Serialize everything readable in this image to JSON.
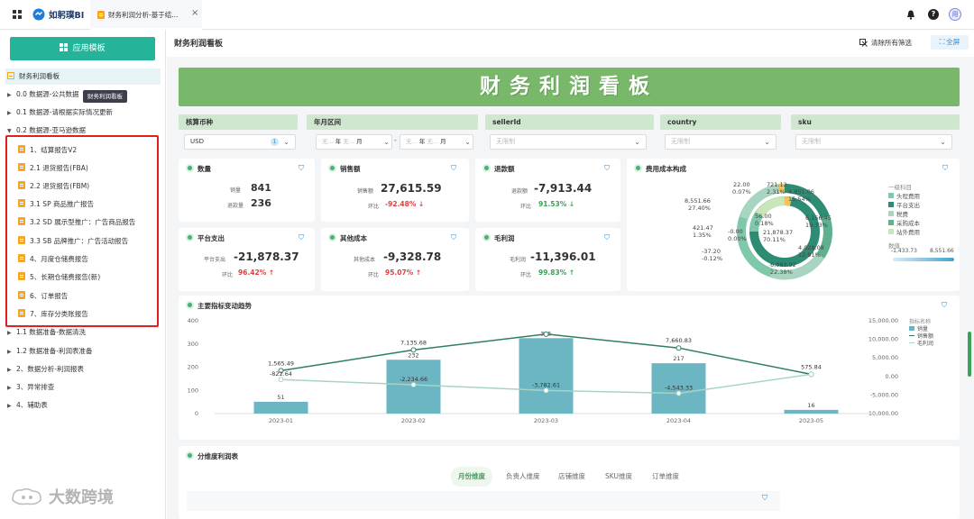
{
  "topbar": {
    "logo_text": "如躬璞BI",
    "tab_title": "财务利润分析-基于结...",
    "tab_close": "×"
  },
  "sidebar": {
    "template_button": "应用模板",
    "tooltip": "财务利润看板",
    "items": [
      {
        "label": "财务利润看板",
        "type": "dashboard"
      },
      {
        "label": "0.0 数据源-公共数据",
        "type": "folder",
        "arrow": "▶"
      },
      {
        "label": "0.1 数据源-请根据实际情况更新",
        "type": "folder",
        "arrow": "▶"
      },
      {
        "label": "0.2 数据源-亚马逊数据",
        "type": "folder",
        "arrow": "▼"
      },
      {
        "label": "1、结算报告V2",
        "type": "doc"
      },
      {
        "label": "2.1 退货报告(FBA)",
        "type": "doc"
      },
      {
        "label": "2.2 退货报告(FBM)",
        "type": "doc"
      },
      {
        "label": "3.1 SP 商品推广报告",
        "type": "doc"
      },
      {
        "label": "3.2 SD 展示型推广：广告商品报告",
        "type": "doc"
      },
      {
        "label": "3.3 SB 品牌推广：广告活动报告",
        "type": "doc"
      },
      {
        "label": "4、月度仓储费报告",
        "type": "doc"
      },
      {
        "label": "5、长期仓储费报告(新)",
        "type": "doc"
      },
      {
        "label": "6、订单报告",
        "type": "doc"
      },
      {
        "label": "7、库存分类账报告",
        "type": "doc"
      },
      {
        "label": "1.1 数据准备-数据清洗",
        "type": "folder",
        "arrow": "▶"
      },
      {
        "label": "1.2 数据准备-利润表准备",
        "type": "folder",
        "arrow": "▶"
      },
      {
        "label": "2、数据分析-利润报表",
        "type": "folder",
        "arrow": "▶"
      },
      {
        "label": "3、异常排查",
        "type": "folder",
        "arrow": "▶"
      },
      {
        "label": "4、辅助表",
        "type": "folder",
        "arrow": "▶"
      }
    ],
    "watermark": "大数跨境"
  },
  "main": {
    "page_title": "财务利润看板",
    "clear_filters": "清除所有筛选",
    "fullscreen": "全屏",
    "banner": "财务利润看板",
    "filters": [
      {
        "label": "核算币种",
        "value": "USD",
        "badge": "1"
      },
      {
        "label": "年月区间",
        "v1": "无...",
        "v2": "年",
        "v3": "无...",
        "v4": "月",
        "dash": "-",
        "v5": "无...",
        "v6": "年",
        "v7": "无...",
        "v8": "月"
      },
      {
        "label": "sellerId",
        "placeholder": "无限制"
      },
      {
        "label": "country",
        "placeholder": "无限制"
      },
      {
        "label": "sku",
        "placeholder": "无限制"
      }
    ],
    "kpis": {
      "qty": {
        "title": "数量",
        "l1": "销量",
        "v1": "841",
        "l2": "退款量",
        "v2": "236"
      },
      "sales": {
        "title": "销售额",
        "l1": "销售额",
        "v1": "27,615.59",
        "l2": "环比",
        "v2": "-92.48%",
        "arrow": "↓"
      },
      "refund": {
        "title": "退款额",
        "l1": "退款额",
        "v1": "-7,913.44",
        "l2": "环比",
        "v2": "91.53%",
        "arrow": "↓"
      },
      "platform": {
        "title": "平台支出",
        "l1": "平台支出",
        "v1": "-21,878.37",
        "l2": "环比",
        "v2": "96.42%",
        "arrow": "↑"
      },
      "other": {
        "title": "其他成本",
        "l1": "其他成本",
        "v1": "-9,328.78",
        "l2": "环比",
        "v2": "95.07%",
        "arrow": "↑"
      },
      "gross": {
        "title": "毛利润",
        "l1": "毛利润",
        "v1": "-11,396.01",
        "l2": "环比",
        "v2": "99.83%",
        "arrow": "↑"
      }
    },
    "cost": {
      "title": "费用成本构成",
      "legend_title": "一级科目",
      "legend": [
        {
          "name": "头程费用",
          "color": "#7fc8a9"
        },
        {
          "name": "平台支出",
          "color": "#2e8b74"
        },
        {
          "name": "税费",
          "color": "#a8d5c2"
        },
        {
          "name": "采购成本",
          "color": "#5fb08f"
        },
        {
          "name": "站外费用",
          "color": "#c9e6b8"
        }
      ],
      "range_label": "数值",
      "range_min": "-1,433.73",
      "range_max": "8,551.66",
      "labels": [
        "22.00",
        "0.07%",
        "721.12",
        "2.31%",
        "4,851.06",
        "15.54%",
        "8,551.66",
        "27.40%",
        "6,156.45",
        "19.73%",
        "421.47",
        "1.35%",
        "-0.00",
        "0.00%",
        "-37.20",
        "-0.12%",
        "4,028.08",
        "12.91%",
        "6,983.92",
        "22.38%",
        "56.00",
        "0.18%",
        "21,878.37",
        "70.11%"
      ]
    },
    "trend": {
      "title": "主要指标变动趋势",
      "legend_title": "指标名称",
      "legend": [
        "销量",
        "销售额",
        "毛利润"
      ],
      "yl_ticks": [
        "400",
        "300",
        "200",
        "100",
        "0"
      ],
      "yr_ticks": [
        "15,000.00",
        "10,000.00",
        "5,000.00",
        "0.00",
        "-5,000.00",
        "-10,000.00"
      ]
    },
    "chart_data": {
      "type": "bar",
      "categories": [
        "2023-01",
        "2023-02",
        "2023-03",
        "2023-04",
        "2023-05"
      ],
      "series": [
        {
          "name": "销量",
          "type": "bar",
          "axis": "left",
          "values": [
            51,
            232,
            325,
            217,
            16
          ],
          "color": "#6bb6c2"
        },
        {
          "name": "销售额",
          "type": "line",
          "axis": "right",
          "values": [
            1565.49,
            7135.68,
            11396.01,
            7660.83,
            575.84
          ],
          "labels": [
            "1,565.49",
            "7,135.68",
            "",
            "7,660.83",
            "575.84"
          ],
          "color": "#2e7d6b"
        },
        {
          "name": "毛利润",
          "type": "line",
          "axis": "right",
          "values": [
            -822.64,
            -2234.66,
            -3782.61,
            -4543.33,
            575.84
          ],
          "labels": [
            "-822.64",
            "-2,234.66",
            "-3,782.61",
            "-4,543.33",
            ""
          ],
          "color": "#a6d4c8"
        }
      ],
      "bar_labels": [
        "51",
        "232",
        "325",
        "217",
        "16"
      ],
      "ylim_left": [
        0,
        400
      ],
      "ylim_right": [
        -10000,
        15000
      ]
    },
    "dim": {
      "title": "分维度利润表",
      "tabs": [
        "月份维度",
        "负责人维度",
        "店铺维度",
        "SKU维度",
        "订单维度"
      ]
    }
  }
}
